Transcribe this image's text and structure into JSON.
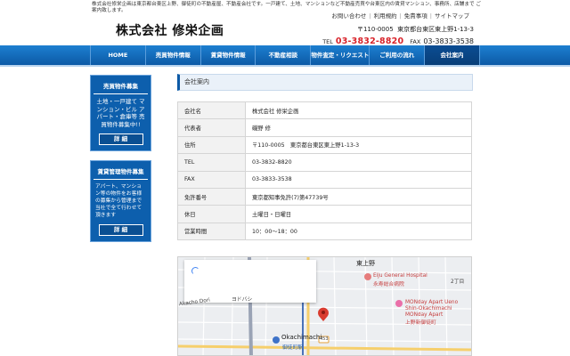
{
  "header": {
    "tagline": "株式会社修栄企画は東京都台東区上野、御徒町の不動産屋、不動産会社です。一戸建て、土地、マンションなど不動産売買や台東区内の賃貸マンション、事務所、店舗まで ご案内致します。",
    "links": [
      "お問い合わせ",
      "利用規約",
      "免責事項",
      "サイトマップ"
    ],
    "logo": "株式会社 修栄企画",
    "postal": "〒110-0005",
    "address": "東京都台東区東上野1-13-3",
    "tel_label": "TEL",
    "tel": "03-3832-8820",
    "fax_label": "FAX",
    "fax": "03-3833-3538"
  },
  "nav": {
    "items": [
      "HOME",
      "売買物件情報",
      "賃貸物件情報",
      "不動産相談",
      "物件査定・リクエスト",
      "ご利用の流れ",
      "会社案内"
    ],
    "active_index": 6
  },
  "sidebar": {
    "card1": {
      "title": "売買物件募集",
      "text": "土地・一戸建て マンション・ビル アパート・倉庫等 売買物件募集中!!",
      "button": "詳 細"
    },
    "card2": {
      "title": "賃貸管理物件募集",
      "text": "アパート、マンション等の物件をお客様の募集から管理まで当社で全て行わせて頂きます",
      "button": "詳 細"
    }
  },
  "main": {
    "heading": "会社案内",
    "rows": [
      {
        "label": "会社名",
        "value": "株式会社 修栄企画"
      },
      {
        "label": "代表者",
        "value": "磯野 修"
      },
      {
        "label": "住所",
        "value": "〒110-0005　東京都台東区東上野1-13-3"
      },
      {
        "label": "TEL",
        "value": "03-3832-8820"
      },
      {
        "label": "FAX",
        "value": "03-3833-3538"
      },
      {
        "label": "免許番号",
        "value": "東京都知事免許(7)第47739号"
      },
      {
        "label": "休日",
        "value": "土曜日・日曜日"
      },
      {
        "label": "営業時間",
        "value": "10：00～18：00"
      }
    ]
  },
  "map": {
    "labels": {
      "higashiueno": "東上野",
      "eiju_en": "Eiju General Hospital",
      "eiju_jp": "永寿総合病院",
      "monday1": "MONday Apart Ueno",
      "monday2": "Shin-Okachimachi",
      "monday3": "MONday Apart",
      "monday4": "上野新御徒町",
      "okachimachi_en": "Okachimachi",
      "okachimachi_jp": "御徒町駅",
      "route": "453",
      "chome": "2丁目",
      "yoshida": "ヨドバシ",
      "achoe": "Akacho Dori"
    }
  }
}
